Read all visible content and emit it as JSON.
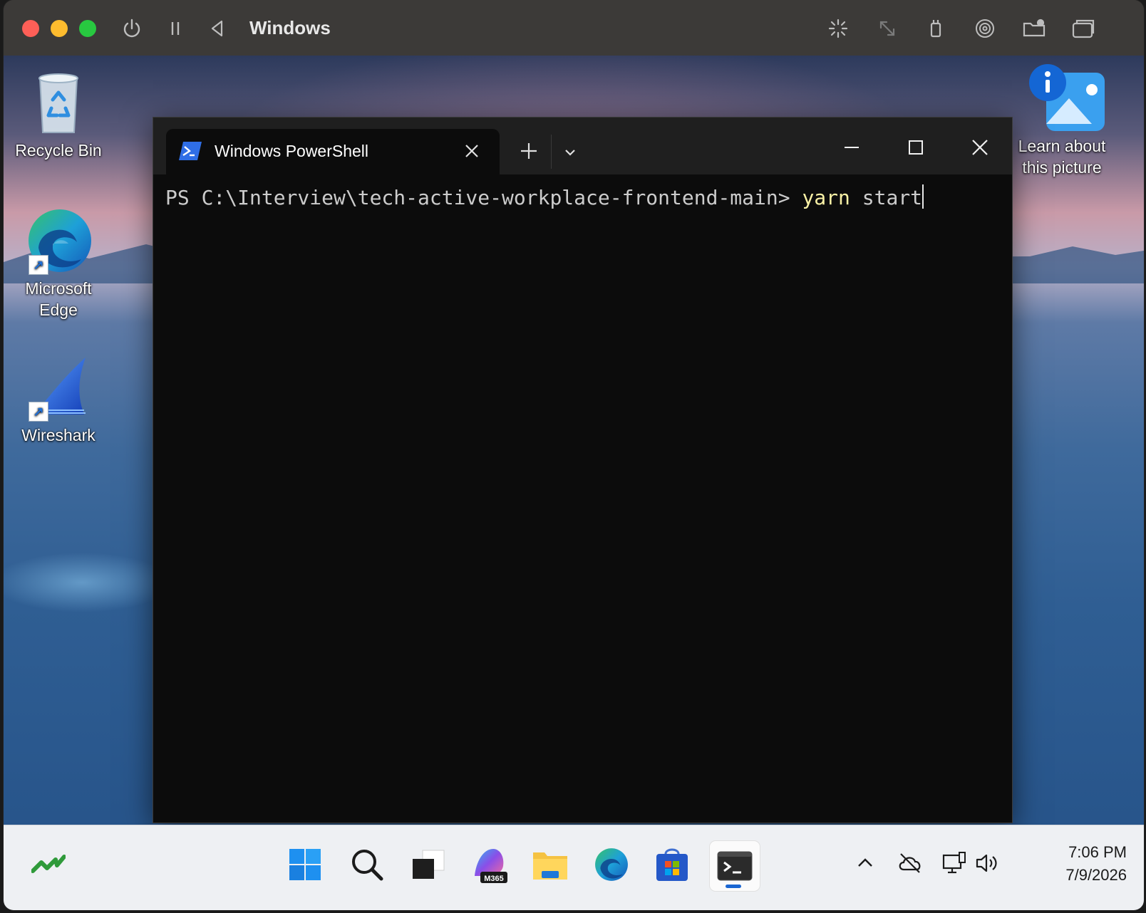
{
  "vm": {
    "title": "Windows",
    "toolbar_icons": [
      "power-icon",
      "pause-icon",
      "back-icon",
      "activity-icon",
      "resize-icon",
      "usb-icon",
      "disc-icon",
      "shared-folder-icon",
      "window-icon"
    ]
  },
  "desktop": {
    "icons": [
      {
        "label": "Recycle Bin"
      },
      {
        "label": "Microsoft Edge"
      },
      {
        "label": "Wireshark"
      },
      {
        "label": "Learn about this picture"
      }
    ]
  },
  "terminal": {
    "tab_title": "Windows PowerShell",
    "prompt": "PS C:\\Interview\\tech-active-workplace-frontend-main> ",
    "command": "yarn",
    "args": " start"
  },
  "taskbar": {
    "apps": [
      "start-icon",
      "search-icon",
      "task-view-icon",
      "m365-icon",
      "file-explorer-icon",
      "edge-icon",
      "store-icon",
      "terminal-icon"
    ],
    "m365_badge": "M365",
    "time": "7:06 PM",
    "date": "7/9/2026"
  },
  "colors": {
    "terminal_bg": "#0c0c0c",
    "command_yellow": "#f9f1a5",
    "taskbar_bg": "#eef0f3",
    "accent_blue": "#1a66d2"
  }
}
